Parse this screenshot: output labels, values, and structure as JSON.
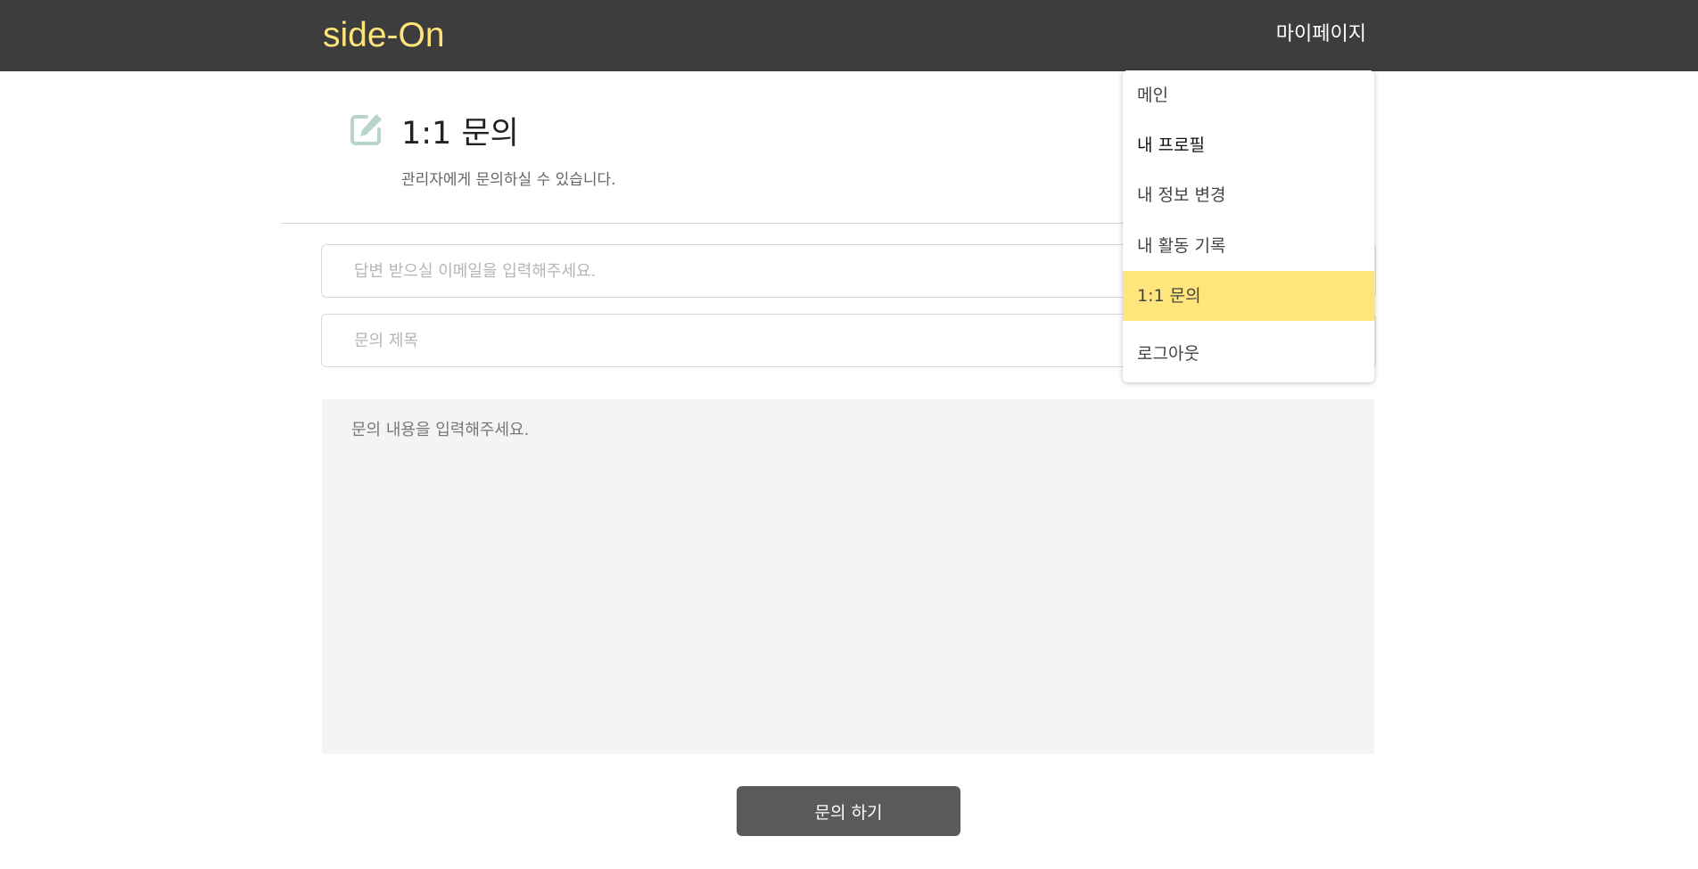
{
  "header": {
    "logo": "side-On",
    "mypage_label": "마이페이지"
  },
  "page": {
    "title": "1:1 문의",
    "subtitle": "관리자에게 문의하실 수 있습니다.",
    "icon": "edit-icon"
  },
  "form": {
    "email_placeholder": "답변 받으실 이메일을 입력해주세요.",
    "email_value": "",
    "title_placeholder": "문의 제목",
    "title_value": "",
    "content_placeholder": "문의 내용을 입력해주세요.",
    "content_value": "",
    "submit_label": "문의 하기"
  },
  "menu": {
    "items": [
      {
        "label": "메인"
      },
      {
        "label": "내 프로필"
      },
      {
        "label": "내 정보 변경"
      },
      {
        "label": "내 활동 기록"
      },
      {
        "label": "1:1 문의",
        "active": true
      },
      {
        "label": "로그아웃"
      }
    ]
  },
  "colors": {
    "topbar": "#3d3d3d",
    "logo": "#ffe47a",
    "active_menu": "#ffe67c",
    "icon": "#b8d6c8",
    "button": "#5a5a5a"
  }
}
